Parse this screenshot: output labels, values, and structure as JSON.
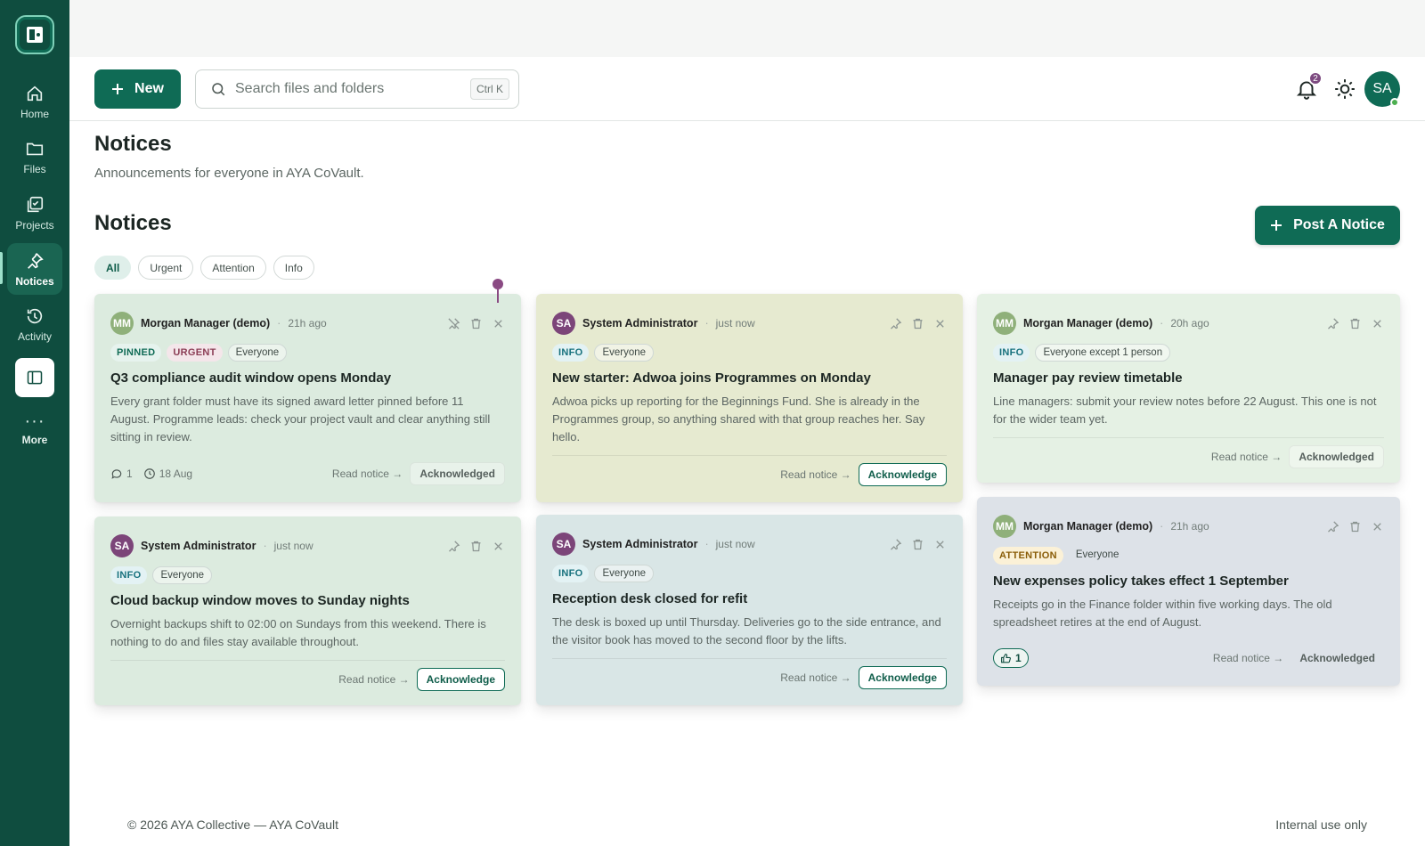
{
  "sidebar": {
    "items": [
      {
        "label": "Home",
        "icon": "home-icon"
      },
      {
        "label": "Files",
        "icon": "folder-icon"
      },
      {
        "label": "Projects",
        "icon": "projects-icon"
      },
      {
        "label": "Notices",
        "icon": "pin-icon",
        "active": true
      },
      {
        "label": "Activity",
        "icon": "history-icon"
      },
      {
        "label": "More",
        "icon": "more-icon"
      }
    ]
  },
  "header": {
    "new_label": "New",
    "search_placeholder": "Search files and folders",
    "search_shortcut": "Ctrl K",
    "notification_count": "2",
    "user_initials": "SA"
  },
  "page": {
    "title": "Notices",
    "subtitle": "Announcements for everyone in AYA CoVault.",
    "section_title": "Notices",
    "post_label": "Post A Notice",
    "filters": [
      "All",
      "Urgent",
      "Attention",
      "Info"
    ],
    "active_filter": "All"
  },
  "notices": [
    {
      "initials": "MM",
      "author": "Morgan Manager (demo)",
      "time": "21h ago",
      "tags": [
        "PINNED",
        "URGENT"
      ],
      "audience": "Everyone",
      "title": "Q3 compliance audit window opens Monday",
      "body": "Every grant folder must have its signed award letter pinned before 11 August. Programme leads: check your project vault and clear anything still sitting in review.",
      "comments": "1",
      "due": "18 Aug",
      "read_label": "Read notice →",
      "ack_label": "Acknowledged",
      "acknowledged": true
    },
    {
      "initials": "SA",
      "author": "System Administrator",
      "time": "just now",
      "tags": [
        "INFO"
      ],
      "audience": "Everyone",
      "title": "New starter: Adwoa joins Programmes on Monday",
      "body": "Adwoa picks up reporting for the Beginnings Fund. She is already in the Programmes group, so anything shared with that group reaches her. Say hello.",
      "read_label": "Read notice →",
      "ack_label": "Acknowledge",
      "acknowledged": false
    },
    {
      "initials": "MM",
      "author": "Morgan Manager (demo)",
      "time": "20h ago",
      "tags": [
        "INFO"
      ],
      "audience": "Everyone except 1 person",
      "title": "Manager pay review timetable",
      "body": "Line managers: submit your review notes before 22 August. This one is not for the wider team yet.",
      "read_label": "Read notice →",
      "ack_label": "Acknowledged",
      "acknowledged": true
    },
    {
      "initials": "SA",
      "author": "System Administrator",
      "time": "just now",
      "tags": [
        "INFO"
      ],
      "audience": "Everyone",
      "title": "Cloud backup window moves to Sunday nights",
      "body": "Overnight backups shift to 02:00 on Sundays from this weekend. There is nothing to do and files stay available throughout.",
      "read_label": "Read notice →",
      "ack_label": "Acknowledge",
      "acknowledged": false
    },
    {
      "initials": "SA",
      "author": "System Administrator",
      "time": "just now",
      "tags": [
        "INFO"
      ],
      "audience": "Everyone",
      "title": "Reception desk closed for refit",
      "body": "The desk is boxed up until Thursday. Deliveries go to the side entrance, and the visitor book has moved to the second floor by the lifts.",
      "read_label": "Read notice →",
      "ack_label": "Acknowledge",
      "acknowledged": false
    },
    {
      "initials": "MM",
      "author": "Morgan Manager (demo)",
      "time": "21h ago",
      "tags": [
        "ATTENTION"
      ],
      "audience": "Everyone",
      "title": "New expenses policy takes effect 1 September",
      "body": "Receipts go in the Finance folder within five working days. The old spreadsheet retires at the end of August.",
      "reactions": "1",
      "read_label": "Read notice →",
      "ack_label": "Acknowledged",
      "acknowledged": true
    }
  ],
  "footer": {
    "left": "© 2026 AYA Collective — AYA CoVault",
    "right": "Internal use only"
  },
  "colors": {
    "brand": "#0f4d3f",
    "accent": "#0f6b55",
    "card_green": "#dcebdf",
    "card_yellow": "#e6ead0",
    "card_blue": "#d9e6e6",
    "card_mint": "#e5f1e4",
    "card_lavender": "#dde2e8"
  }
}
